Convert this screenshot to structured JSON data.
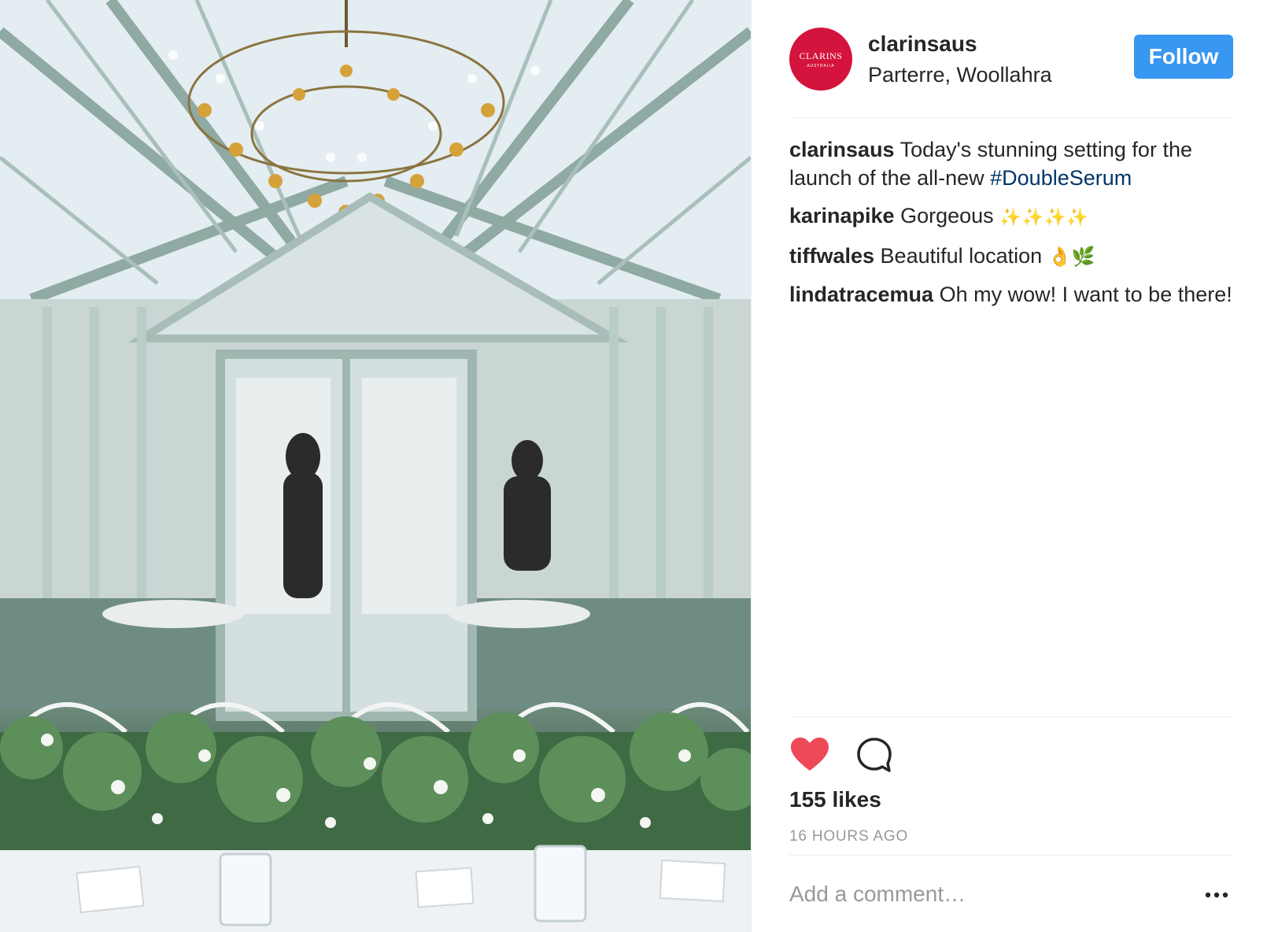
{
  "post": {
    "image_alt": "",
    "header": {
      "avatar_logo": "CLARINS",
      "avatar_logo_sub": "AUSTRALIA",
      "username": "clarinsaus",
      "location": "Parterre, Woollahra",
      "follow_label": "Follow"
    },
    "comments": [
      {
        "user": "clarinsaus",
        "text": "Today's stunning setting for the launch of the all-new ",
        "hashtag": "#DoubleSerum"
      },
      {
        "user": "karinapike",
        "text": "Gorgeous",
        "emoji": "✨✨✨✨"
      },
      {
        "user": "tiffwales",
        "text": "Beautiful location",
        "emoji_ok": "👌",
        "emoji_herb": "🌿"
      },
      {
        "user": "lindatracemua",
        "text": "Oh my wow! I want to be there!"
      }
    ],
    "actions": {
      "like_icon": "heart-icon",
      "comment_icon": "comment-bubble-icon",
      "liked_color": "#ed4956"
    },
    "likes_text": "155 likes",
    "timestamp": "16 HOURS AGO",
    "add_comment_placeholder": "Add a comment…",
    "more_icon": "more-options-icon",
    "colors": {
      "follow_button": "#3897f0",
      "avatar_bg": "#d4143c",
      "hashtag": "#003569",
      "muted_text": "#999999"
    }
  }
}
